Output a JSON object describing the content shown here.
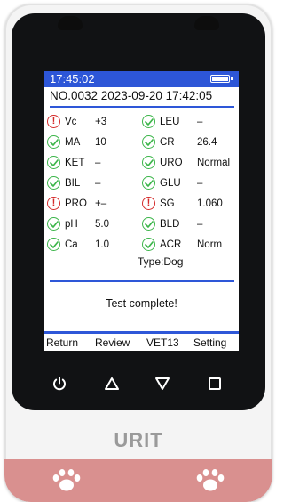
{
  "device": {
    "brand": "URIT",
    "colors": {
      "screen_accent": "#2e57d8",
      "ok": "#3cb54a",
      "warn": "#d42a2a",
      "strip": "#d9908f"
    }
  },
  "status_bar": {
    "time": "17:45:02",
    "battery_icon": "battery-full-icon"
  },
  "header": {
    "record": "NO.0032 2023-09-20 17:42:05"
  },
  "results": [
    {
      "left": {
        "status": "warn",
        "name": "Vc",
        "value": "+3"
      },
      "right": {
        "status": "ok",
        "name": "LEU",
        "value": "–"
      }
    },
    {
      "left": {
        "status": "ok",
        "name": "MA",
        "value": "10"
      },
      "right": {
        "status": "ok",
        "name": "CR",
        "value": "26.4"
      }
    },
    {
      "left": {
        "status": "ok",
        "name": "KET",
        "value": "–"
      },
      "right": {
        "status": "ok",
        "name": "URO",
        "value": "Normal"
      }
    },
    {
      "left": {
        "status": "ok",
        "name": "BIL",
        "value": "–"
      },
      "right": {
        "status": "ok",
        "name": "GLU",
        "value": "–"
      }
    },
    {
      "left": {
        "status": "warn",
        "name": "PRO",
        "value": "+–"
      },
      "right": {
        "status": "warn",
        "name": "SG",
        "value": "1.060"
      }
    },
    {
      "left": {
        "status": "ok",
        "name": "pH",
        "value": "5.0"
      },
      "right": {
        "status": "ok",
        "name": "BLD",
        "value": "–"
      }
    },
    {
      "left": {
        "status": "ok",
        "name": "Ca",
        "value": "1.0"
      },
      "right": {
        "status": "ok",
        "name": "ACR",
        "value": "Norm"
      }
    }
  ],
  "sample_type": "Type:Dog",
  "status_message": "Test complete!",
  "softkeys": [
    "Return",
    "Review",
    "VET13",
    "Setting"
  ],
  "hardware_buttons": [
    "power-icon",
    "up-triangle-icon",
    "down-triangle-icon",
    "square-icon"
  ]
}
